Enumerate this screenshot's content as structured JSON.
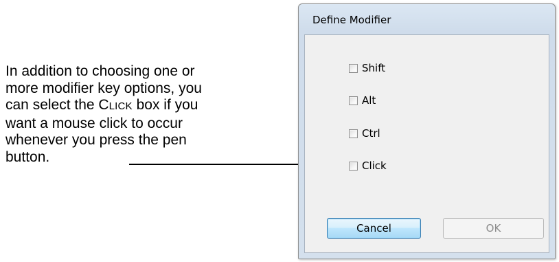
{
  "callout": {
    "line1": "In addition to choosing one or",
    "line2": "more modifier key options, you",
    "line3_pre": "can select the ",
    "line3_click_c": "C",
    "line3_click_rest": "LICK",
    "line3_post": " box if you",
    "line4": "want a mouse click to occur",
    "line5": "whenever you press the pen",
    "line6": "button."
  },
  "dialog": {
    "title": "Define Modifier",
    "checkboxes": [
      {
        "label": "Shift",
        "checked": false
      },
      {
        "label": "Alt",
        "checked": false
      },
      {
        "label": "Ctrl",
        "checked": false
      },
      {
        "label": "Click",
        "checked": false
      }
    ],
    "buttons": {
      "cancel": "Cancel",
      "ok": "OK"
    }
  }
}
